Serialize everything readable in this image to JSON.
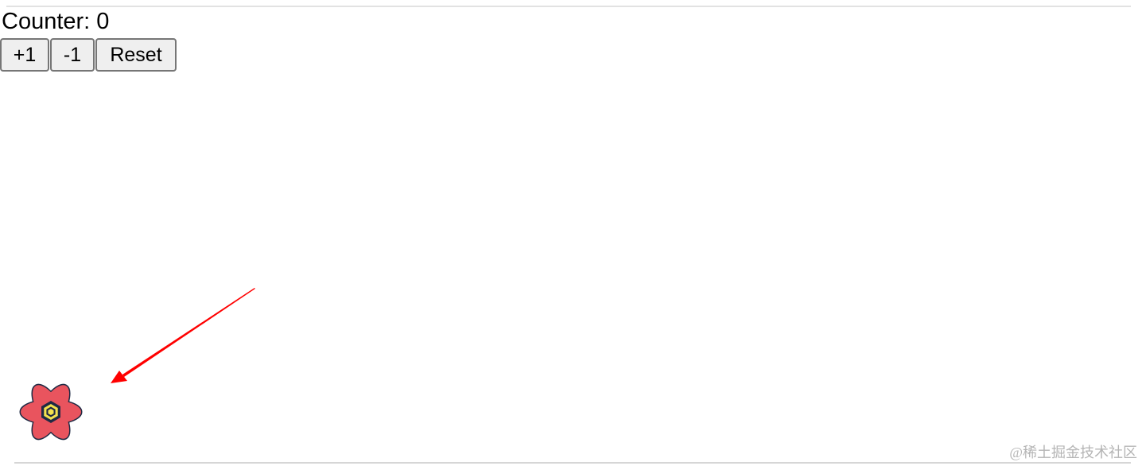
{
  "counter": {
    "label": "Counter: 0"
  },
  "controls": {
    "increment_label": "+1",
    "decrement_label": "-1",
    "reset_label": "Reset"
  },
  "annotation": {
    "arrow_color": "#ff0000",
    "points_to": "devtools-toggle-icon"
  },
  "devtools_button": {
    "icon": "react-atom-icon",
    "colors": {
      "petals": "#e9545e",
      "outline": "#1f2a44",
      "core": "#f3e24f"
    }
  },
  "watermark": {
    "text": "@稀土掘金技术社区"
  }
}
